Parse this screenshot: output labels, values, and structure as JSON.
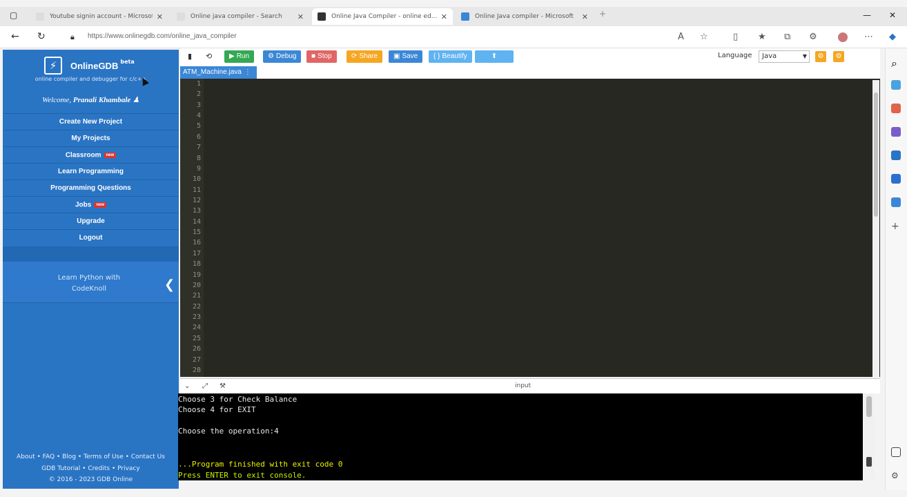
{
  "browser": {
    "tabs": [
      {
        "title": "Youtube signin account - Microsoft Edge",
        "icon": "page-icon",
        "active": false
      },
      {
        "title": "Online java compiler - Search",
        "icon": "page-icon",
        "active": false
      },
      {
        "title": "Online Java Compiler - online ed...",
        "icon": "gdb-icon",
        "active": true
      },
      {
        "title": "Online Java compiler - Microsoft",
        "icon": "search-icon",
        "active": false
      }
    ],
    "url": "https://www.onlinegdb.com/online_java_compiler"
  },
  "sidebar": {
    "brand": "OnlineGDB",
    "beta": "beta",
    "tagline": "online compiler and debugger for c/c++",
    "welcome_prefix": "Welcome, ",
    "user": "Pranali Khambale",
    "menu": [
      {
        "label": "Create New Project",
        "badge": ""
      },
      {
        "label": "My Projects",
        "badge": ""
      },
      {
        "label": "Classroom",
        "badge": "new"
      },
      {
        "label": "Learn Programming",
        "badge": ""
      },
      {
        "label": "Programming Questions",
        "badge": ""
      },
      {
        "label": "Jobs",
        "badge": "new"
      },
      {
        "label": "Upgrade",
        "badge": ""
      },
      {
        "label": "Logout",
        "badge": ""
      }
    ],
    "promo_line1": "Learn Python with",
    "promo_line2": "CodeKnoll",
    "footer_line1": "About • FAQ • Blog • Terms of Use • Contact Us",
    "footer_line2": "GDB Tutorial • Credits • Privacy",
    "footer_line3": "© 2016 - 2023 GDB Online"
  },
  "toolbar": {
    "run": "Run",
    "debug": "Debug",
    "stop": "Stop",
    "share": "Share",
    "save": "Save",
    "beautify": "Beautify",
    "language_label": "Language",
    "language_value": "Java"
  },
  "editor": {
    "file_tab": "ATM_Machine.java",
    "lines": [
      "1",
      "2",
      "3",
      "4",
      "5",
      "6",
      "7",
      "8",
      "9",
      "10",
      "11",
      "12",
      "13",
      "14",
      "15",
      "16",
      "17",
      "18",
      "19",
      "20",
      "21",
      "22",
      "23",
      "24",
      "25",
      "26",
      "27",
      "28"
    ]
  },
  "console": {
    "input_label": "input",
    "lines": [
      "Choose 3 for Check Balance",
      "Choose 4 for EXIT",
      "",
      "Choose the operation:4",
      "",
      "",
      "...Program finished with exit code 0",
      "Press ENTER to exit console."
    ]
  },
  "colors": {
    "sidebar": "#2a74c4",
    "run": "#34a853",
    "debug": "#3b87d6",
    "stop": "#e06666",
    "share": "#f5a623",
    "save": "#3b87d6",
    "beautify": "#5fb3f0",
    "editor_bg": "#272822"
  }
}
